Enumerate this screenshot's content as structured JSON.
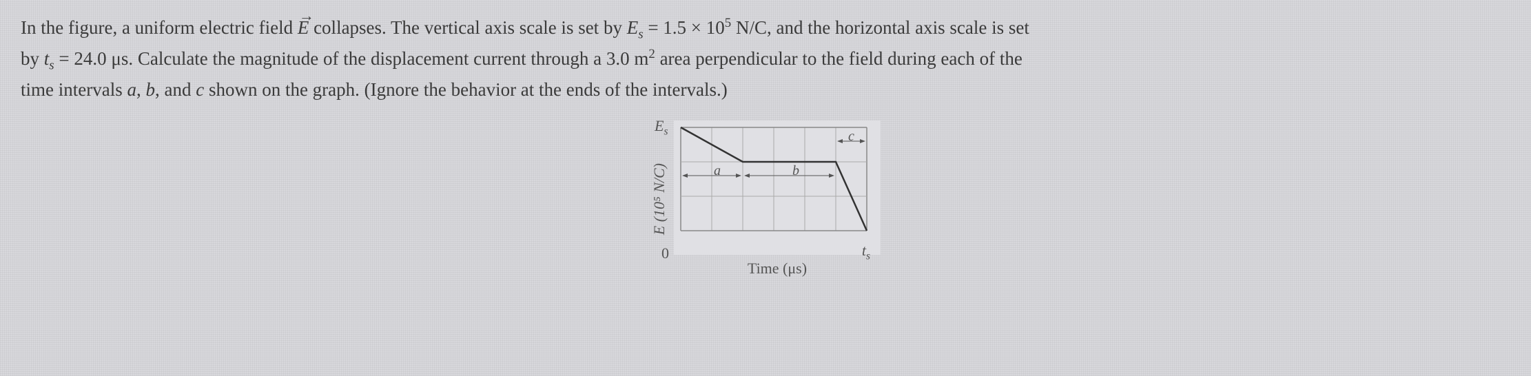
{
  "problem": {
    "line1_part1": "In the figure, a uniform electric field ",
    "line1_vector": "E",
    "line1_part2": " collapses. The vertical axis scale is set by ",
    "line1_es_var": "E",
    "line1_es_sub": "s",
    "line1_es_eq": " = 1.5 × 10",
    "line1_es_exp": "5",
    "line1_es_unit": " N/C, and the horizontal axis scale is set",
    "line2_part1": "by ",
    "line2_ts_var": "t",
    "line2_ts_sub": "s",
    "line2_ts_val": " = 24.0 μs. Calculate the magnitude of the displacement current through a 3.0 m",
    "line2_area_exp": "2",
    "line2_part2": " area perpendicular to the field during each of the",
    "line3": "time intervals ",
    "line3_a": "a",
    "line3_sep1": ", ",
    "line3_b": "b",
    "line3_sep2": ", and ",
    "line3_c": "c",
    "line3_end": " shown on the graph. (Ignore the behavior at the ends of the intervals.)"
  },
  "chart": {
    "y_label": "E (10⁵ N/C)",
    "x_label": "Time (μs)",
    "y_tick_top_var": "E",
    "y_tick_top_sub": "s",
    "y_tick_bottom": "0",
    "x_tick_right_var": "t",
    "x_tick_right_sub": "s",
    "label_a": "a",
    "label_b": "b",
    "label_c": "c"
  },
  "chart_data": {
    "type": "line",
    "title": "",
    "xlabel": "Time (μs)",
    "ylabel": "E (10⁵ N/C)",
    "xlim": [
      0,
      24.0
    ],
    "ylim": [
      0,
      1.5
    ],
    "grid_x_divisions": 6,
    "grid_y_divisions": 3,
    "series": [
      {
        "name": "E-field",
        "x": [
          0,
          8,
          20,
          24
        ],
        "y": [
          1.5,
          1.0,
          1.0,
          0
        ]
      }
    ],
    "intervals": [
      {
        "name": "a",
        "x_start": 0,
        "x_end": 8
      },
      {
        "name": "b",
        "x_start": 8,
        "x_end": 20
      },
      {
        "name": "c",
        "x_start": 20,
        "x_end": 24
      }
    ]
  }
}
